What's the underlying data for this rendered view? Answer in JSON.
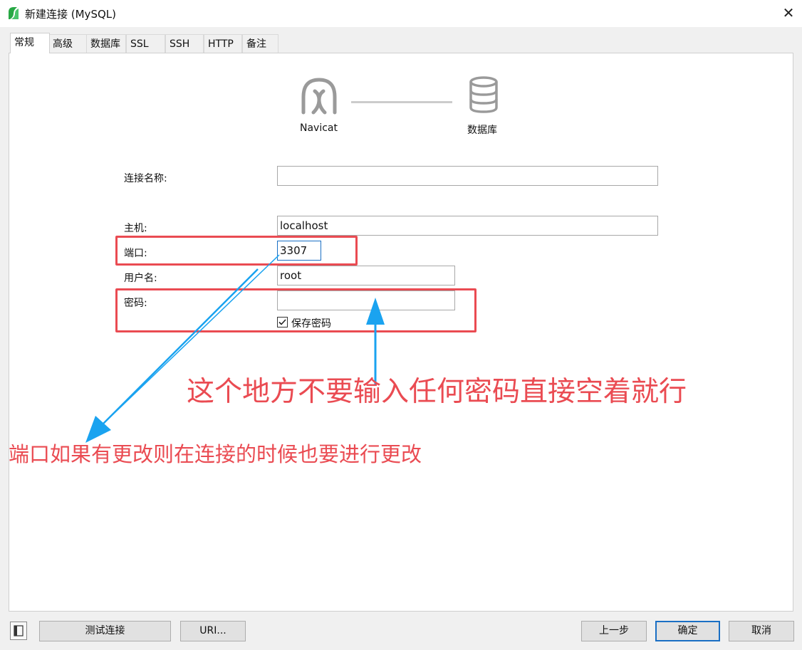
{
  "window": {
    "title": "新建连接 (MySQL)",
    "close_symbol": "✕"
  },
  "tabs": [
    {
      "label": "常规",
      "active": true
    },
    {
      "label": "高级"
    },
    {
      "label": "数据库"
    },
    {
      "label": "SSL"
    },
    {
      "label": "SSH"
    },
    {
      "label": "HTTP"
    },
    {
      "label": "备注"
    }
  ],
  "diagram": {
    "left_label": "Navicat",
    "right_label": "数据库",
    "left_icon": "navicat-logo-icon",
    "right_icon": "database-icon"
  },
  "form": {
    "connection_name": {
      "label": "连接名称:",
      "value": ""
    },
    "host": {
      "label": "主机:",
      "value": "localhost"
    },
    "port": {
      "label": "端口:",
      "value": "3307"
    },
    "username": {
      "label": "用户名:",
      "value": "root"
    },
    "password": {
      "label": "密码:",
      "value": ""
    },
    "save_password": {
      "label": "保存密码",
      "checked": true
    }
  },
  "annotations": {
    "password_note": "这个地方不要输入任何密码直接空着就行",
    "port_note": "端口如果有更改则在连接的时候也要进行更改",
    "box_color": "#ea4b52",
    "arrow_color": "#1aa3f0"
  },
  "buttons": {
    "test_connection": "测试连接",
    "uri": "URI...",
    "previous": "上一步",
    "ok": "确定",
    "cancel": "取消"
  },
  "colors": {
    "accent": "#1a6fc4",
    "window_bg": "#f0f0f0",
    "panel_bg": "#ffffff"
  }
}
